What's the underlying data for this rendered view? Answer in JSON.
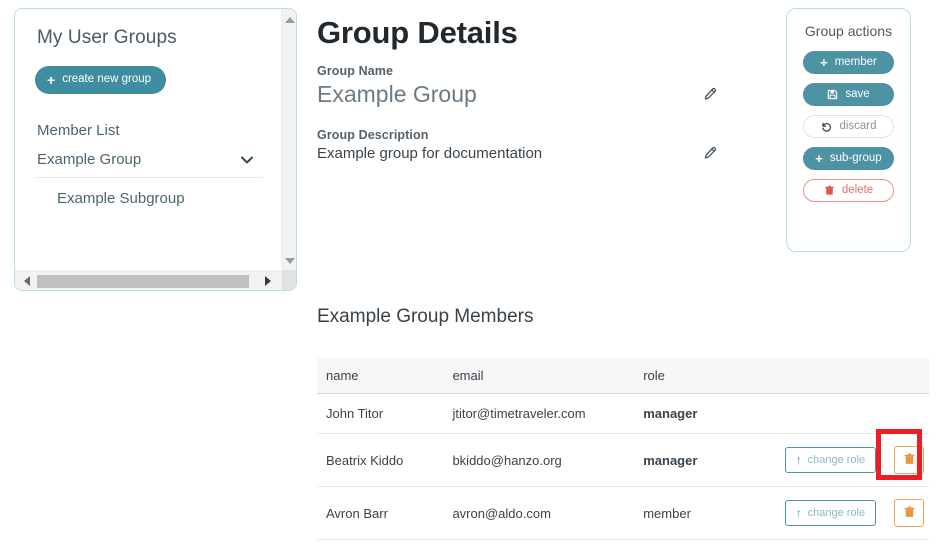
{
  "sidebar": {
    "title": "My User Groups",
    "create_button": {
      "label": "create new group",
      "icon": "plus-icon"
    },
    "items": [
      {
        "label": "Member List",
        "level": 0,
        "expandable": false
      },
      {
        "label": "Example Group",
        "level": 0,
        "expandable": true,
        "icon": "chevron-down-icon"
      },
      {
        "label": "Example Subgroup",
        "level": 1,
        "expandable": false
      }
    ],
    "scrollbars": {
      "vertical": true,
      "horizontal": true
    }
  },
  "details": {
    "title": "Group Details",
    "name_label": "Group Name",
    "name_value": "Example Group",
    "description_label": "Group Description",
    "description_value": "Example group for documentation",
    "edit_icon": "pencil-icon"
  },
  "actions": {
    "title": "Group actions",
    "buttons": [
      {
        "label": "member",
        "icon": "plus-icon",
        "style": "primary"
      },
      {
        "label": "save",
        "icon": "save-icon",
        "style": "primary"
      },
      {
        "label": "discard",
        "icon": "undo-icon",
        "style": "ghost"
      },
      {
        "label": "sub-group",
        "icon": "plus-icon",
        "style": "primary"
      },
      {
        "label": "delete",
        "icon": "trash-icon",
        "style": "danger"
      }
    ]
  },
  "members": {
    "title": "Example Group Members",
    "columns": [
      "name",
      "email",
      "role"
    ],
    "row_action_label": "change role",
    "row_action_icon": "arrow-up-icon",
    "delete_icon": "trash-icon",
    "rows": [
      {
        "name": "John Titor",
        "email": "jtitor@timetraveler.com",
        "role": "manager",
        "role_bold": true,
        "has_actions": false
      },
      {
        "name": "Beatrix Kiddo",
        "email": "bkiddo@hanzo.org",
        "role": "manager",
        "role_bold": true,
        "has_actions": true,
        "highlighted_delete": true
      },
      {
        "name": "Avron Barr",
        "email": "avron@aldo.com",
        "role": "member",
        "role_bold": false,
        "has_actions": true,
        "highlighted_delete": false
      }
    ]
  },
  "colors": {
    "teal": "#4d93a3",
    "card_border": "#b9dde6",
    "danger_red": "#e1706a",
    "orange": "#e8a95c",
    "highlight_red": "#ee1c25",
    "table_header_bg": "#f7f7f8"
  }
}
